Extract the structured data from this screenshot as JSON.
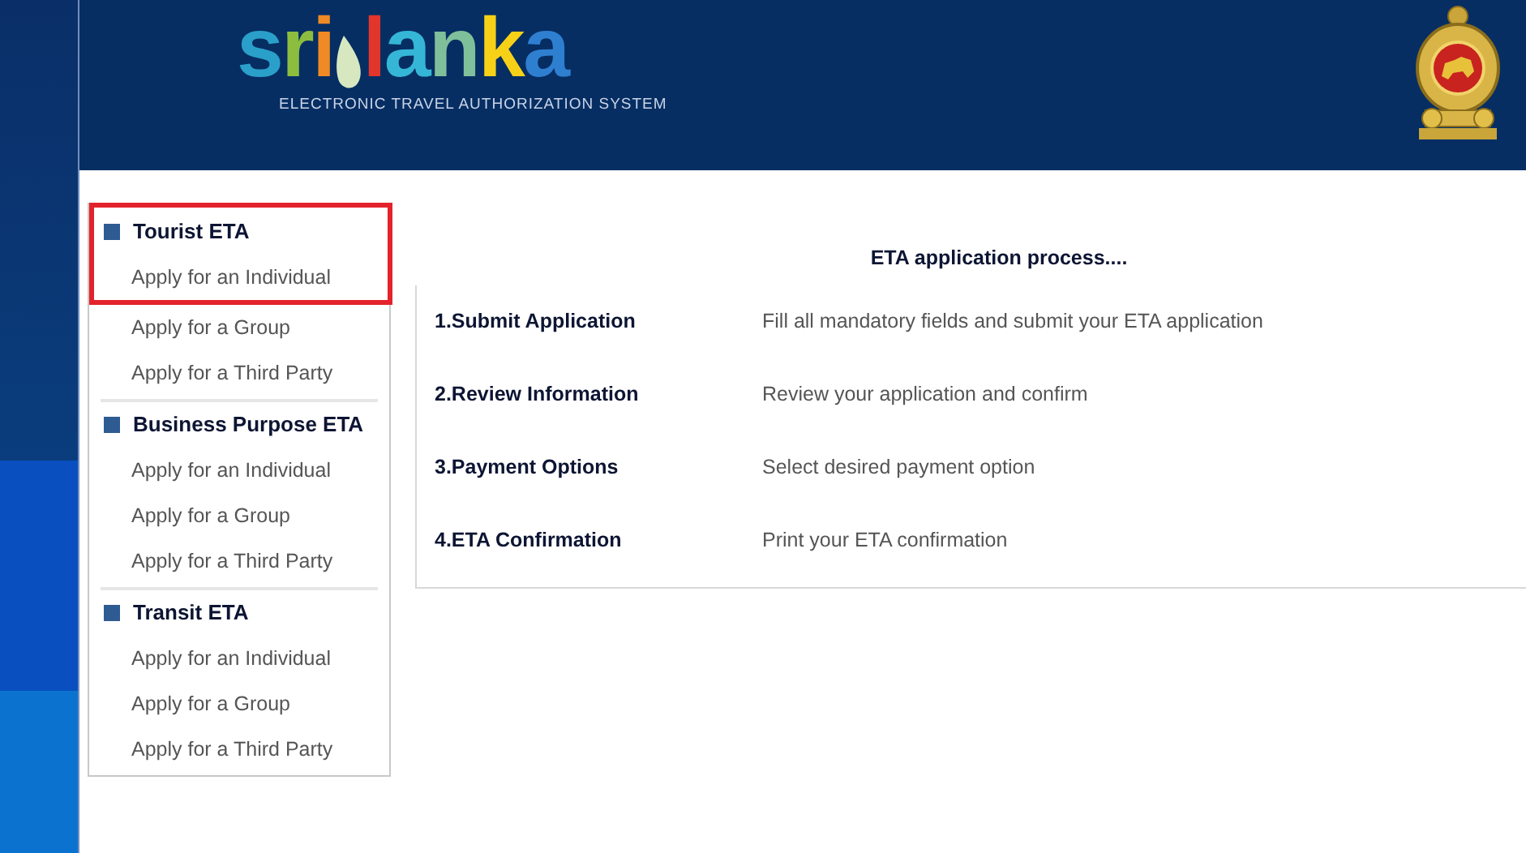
{
  "header": {
    "logo_letters": [
      {
        "text": "s",
        "color": "#2a9fc9"
      },
      {
        "text": "r",
        "color": "#8cbd3f"
      },
      {
        "text": "i",
        "color": "#f08a24"
      },
      {
        "text": "l",
        "color": "#e2352b"
      },
      {
        "text": "a",
        "color": "#35b6d6"
      },
      {
        "text": "n",
        "color": "#7fbf9a"
      },
      {
        "text": "k",
        "color": "#f7d117"
      },
      {
        "text": "a",
        "color": "#2f7fd1"
      }
    ],
    "subtitle": "ELECTRONIC TRAVEL AUTHORIZATION SYSTEM"
  },
  "sidebar": {
    "groups": [
      {
        "title": "Tourist ETA",
        "highlighted": true,
        "items": [
          "Apply for an Individual",
          "Apply for a Group",
          "Apply for a Third Party"
        ]
      },
      {
        "title": "Business Purpose ETA",
        "highlighted": false,
        "items": [
          "Apply for an Individual",
          "Apply for a Group",
          "Apply for a Third Party"
        ]
      },
      {
        "title": "Transit ETA",
        "highlighted": false,
        "items": [
          "Apply for an Individual",
          "Apply for a Group",
          "Apply for a Third Party"
        ]
      }
    ]
  },
  "process": {
    "title": "ETA application process....",
    "steps": [
      {
        "step": "1.Submit Application",
        "description": "Fill all mandatory fields and submit your ETA application"
      },
      {
        "step": "2.Review Information",
        "description": "Review your application and confirm"
      },
      {
        "step": "3.Payment Options",
        "description": "Select desired payment option"
      },
      {
        "step": "4.ETA Confirmation",
        "description": "Print your ETA confirmation"
      }
    ]
  }
}
